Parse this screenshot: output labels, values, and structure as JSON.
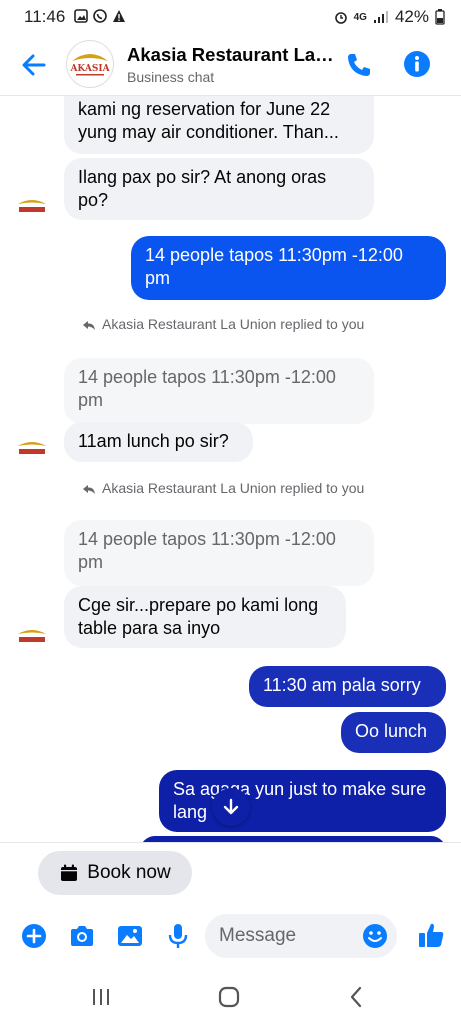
{
  "status": {
    "time": "11:46",
    "network": "4G",
    "battery": "42%"
  },
  "header": {
    "title": "Akasia  Restaurant La Union",
    "subtitle": "Business chat",
    "avatar_text": "AKASIA"
  },
  "messages": {
    "m1_line1": "kami ng reservation for June 22",
    "m1_line2": "yung may air conditioner. Than...",
    "m2": "Ilang pax po sir? At anong oras po?",
    "m3": "14 people tapos 11:30pm -12:00 pm",
    "reply1_label": "Akasia  Restaurant La Union replied to you",
    "quote1": "14 people tapos 11:30pm -12:00 pm",
    "m4": "11am lunch po sir?",
    "reply2_label": "Akasia  Restaurant La Union replied to you",
    "quote2": "14 people tapos 11:30pm -12:00 pm",
    "m5": "Cge sir...prepare po kami long table para sa inyo",
    "m6": "11:30 am pala sorry",
    "m7": "Oo lunch",
    "m8": "Sa agaga yun just to make sure lang"
  },
  "book_now": {
    "label": "Book now"
  },
  "composer": {
    "placeholder": "Message"
  },
  "colors": {
    "accent": "#0a7cff",
    "outgoing_1": "#0a55f0",
    "outgoing_2": "#1a2fb8",
    "outgoing_3": "#0e1fa8",
    "incoming": "#f0f2f5",
    "logo_red": "#c0392b",
    "logo_gold": "#d4a017"
  },
  "icons": {
    "back": "arrow-left-icon",
    "call": "phone-icon",
    "info": "info-icon",
    "add": "plus-circle-icon",
    "camera": "camera-icon",
    "gallery": "image-icon",
    "mic": "microphone-icon",
    "emoji": "smiley-icon",
    "like": "thumbs-up-icon",
    "calendar": "calendar-icon",
    "scroll_down": "arrow-down-icon"
  }
}
